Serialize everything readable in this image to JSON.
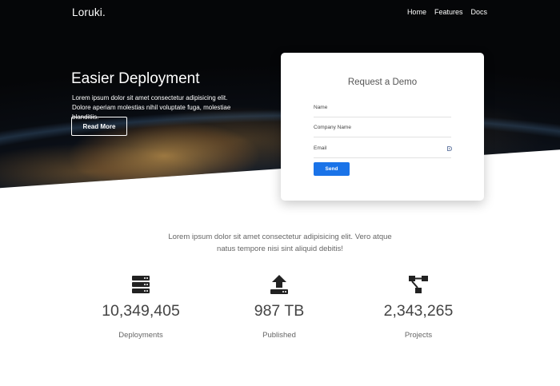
{
  "header": {
    "brand": "Loruki.",
    "nav": [
      "Home",
      "Features",
      "Docs"
    ]
  },
  "hero": {
    "title": "Easier Deployment",
    "text": "Lorem ipsum dolor sit amet consectetur adipisicing elit. Dolore aperiam molestias nihil voluptate fuga, molestiae blanditiis.",
    "button_label": "Read More"
  },
  "demo_form": {
    "title": "Request a Demo",
    "name_placeholder": "Name",
    "company_placeholder": "Company Name",
    "email_placeholder": "Email",
    "send_label": "Send"
  },
  "intro": "Lorem ipsum dolor sit amet consectetur adipisicing elit. Vero atque natus tempore nisi sint aliquid debitis!",
  "stats": [
    {
      "value": "10,349,405",
      "label": "Deployments",
      "icon": "server-icon"
    },
    {
      "value": "987 TB",
      "label": "Published",
      "icon": "upload-icon"
    },
    {
      "value": "2,343,265",
      "label": "Projects",
      "icon": "project-diagram-icon"
    }
  ],
  "colors": {
    "accent": "#1a73e8",
    "hero_dark": "#0a0e15",
    "text_gray": "#666666"
  }
}
